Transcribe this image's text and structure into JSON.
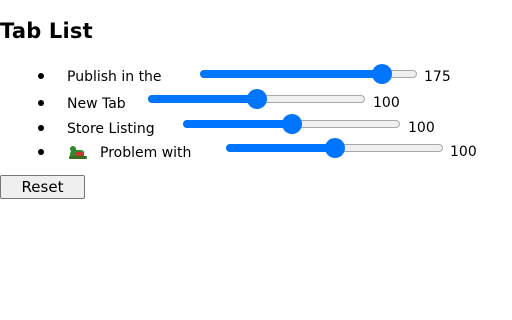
{
  "page": {
    "title": "Tab List"
  },
  "tabs": [
    {
      "label": "Publish in the",
      "value": "175",
      "level": 0.875,
      "has_icon": false
    },
    {
      "label": "New Tab",
      "value": "100",
      "level": 0.5,
      "has_icon": false
    },
    {
      "label": "Store Listing",
      "value": "100",
      "level": 0.5,
      "has_icon": false
    },
    {
      "label": "Problem with",
      "value": "100",
      "level": 0.5,
      "has_icon": true,
      "icon": "puzzle-favicon-icon"
    }
  ],
  "controls": {
    "reset_label": "Reset"
  },
  "colors": {
    "accent": "#0075ff",
    "track": "#efefef",
    "track_border": "#a8a8a8",
    "button_bg": "#efefef",
    "button_border": "#767676"
  }
}
